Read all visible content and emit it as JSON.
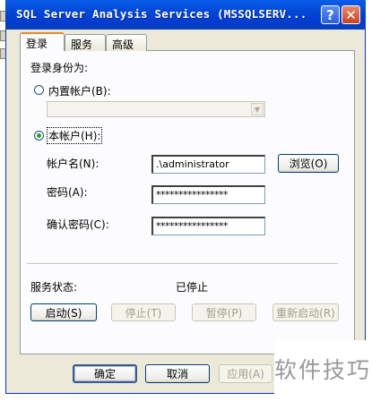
{
  "window": {
    "title": "SQL Server Analysis Services (MSSQLSERV...",
    "help_glyph": "?",
    "close_glyph": "✕"
  },
  "tabs": [
    {
      "label": "登录",
      "active": true
    },
    {
      "label": "服务",
      "active": false
    },
    {
      "label": "高级",
      "active": false
    }
  ],
  "login": {
    "section_label": "登录身份为:",
    "builtin_account_label": "内置帐户(B):",
    "builtin_account_selected": false,
    "builtin_account_value": "",
    "this_account_label": "本帐户(H):",
    "this_account_selected": true,
    "account_name_label": "帐户名(N):",
    "account_name_value": ".\\administrator",
    "browse_button": "浏览(O)",
    "password_label": "密码(A):",
    "password_value": "****************",
    "confirm_password_label": "确认密码(C):",
    "confirm_password_value": "****************"
  },
  "service": {
    "status_label": "服务状态:",
    "status_value": "已停止",
    "start_button": "启动(S)",
    "stop_button": "停止(T)",
    "pause_button": "暂停(P)",
    "restart_button": "重新启动(R)"
  },
  "footer": {
    "ok_button": "确定",
    "cancel_button": "取消",
    "apply_button": "应用(A)"
  },
  "watermark": {
    "text": "软件技巧"
  }
}
